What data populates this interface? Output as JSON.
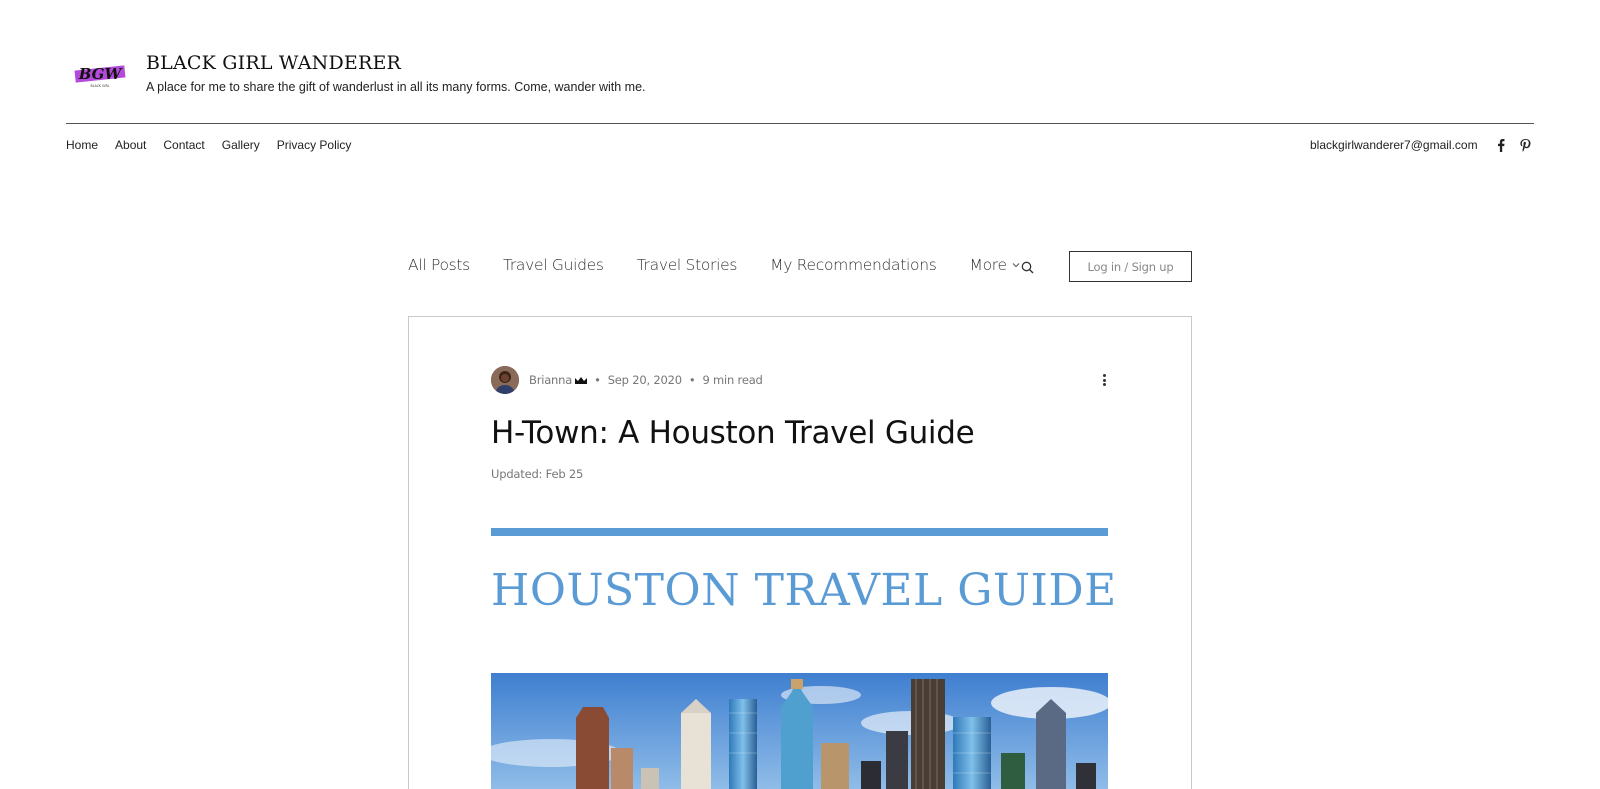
{
  "site": {
    "logo_text": "BGW",
    "title": "BLACK GIRL WANDERER",
    "tagline": "A place for me to share the gift of wanderlust in all its many forms. Come, wander with me.",
    "nav": [
      "Home",
      "About",
      "Contact",
      "Gallery",
      "Privacy Policy"
    ],
    "email": "blackgirlwanderer7@gmail.com",
    "social_icons": [
      "facebook-icon",
      "pinterest-icon"
    ]
  },
  "blog_nav": {
    "items": [
      "All Posts",
      "Travel Guides",
      "Travel Stories",
      "My Recommendations"
    ],
    "more_label": "More",
    "login_label": "Log in / Sign up"
  },
  "post": {
    "author": "Brianna",
    "date": "Sep 20, 2020",
    "read_time": "9 min read",
    "title": "H-Town: A Houston Travel Guide",
    "updated": "Updated: Feb 25",
    "banner_title": "HOUSTON TRAVEL GUIDE"
  },
  "colors": {
    "accent_blue": "#5b9bd5",
    "logo_purple": "#b44ad9",
    "text_dark": "#222222",
    "meta_gray": "#777777",
    "sky_top": "#3f7fd0",
    "sky_bottom": "#9cc6ec"
  }
}
